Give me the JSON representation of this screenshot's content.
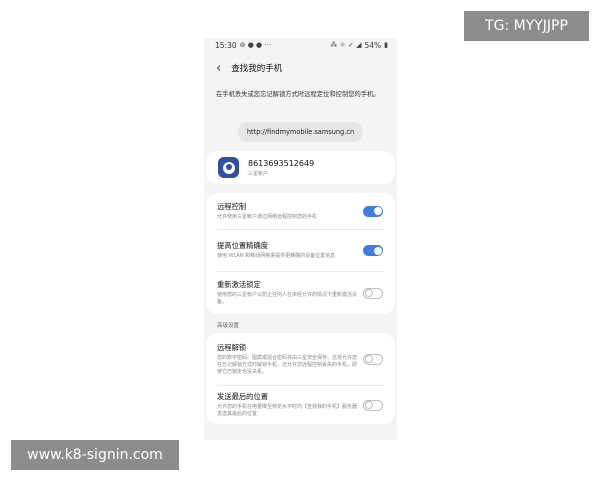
{
  "watermark": {
    "tg": "TG: MYYJJPP",
    "site": "www.k8-signin.com"
  },
  "statusbar": {
    "time": "15:30",
    "left_icons": "⊚ ● ● ···",
    "right_icons": "⁂ ☼ ✓ ◢",
    "battery": "54%"
  },
  "header": {
    "title": "查找我的手机"
  },
  "description": "在手机丢失或您忘记解锁方式时远程定位和控制您的手机。",
  "url": "http://findmymobile.samsung.cn",
  "account": {
    "number": "8613693512649",
    "subtitle": "三星帐户"
  },
  "settings": [
    {
      "title": "远程控制",
      "desc": "允许使用三星帐户通过网络远程控制您的手机",
      "enabled": true
    },
    {
      "title": "提高位置精确度",
      "desc": "使用 WLAN 和移动网络来提供更精确的设备位置信息",
      "enabled": true
    },
    {
      "title": "重新激活锁定",
      "desc": "使用您的三星帐户以防止任何人在未经允许的情况下重新激活设备。",
      "enabled": false
    }
  ],
  "advanced": {
    "label": "高级设置",
    "items": [
      {
        "title": "远程解锁",
        "desc": "您的数字密码、图案或混合密码将由三星安全保存。这将允许您在忘记解锁方式时解锁手机，还允许您远程控制丢失的手机，即使它已锁定也没关系。",
        "enabled": false
      },
      {
        "title": "发送最后的位置",
        "desc": "允许您的手机在电量降至特定水平时向【查找我的手机】服务器发送其最后的位置",
        "enabled": false
      }
    ]
  },
  "colors": {
    "toggle_on": "#3e7ee0",
    "avatar": "#3050a8"
  }
}
